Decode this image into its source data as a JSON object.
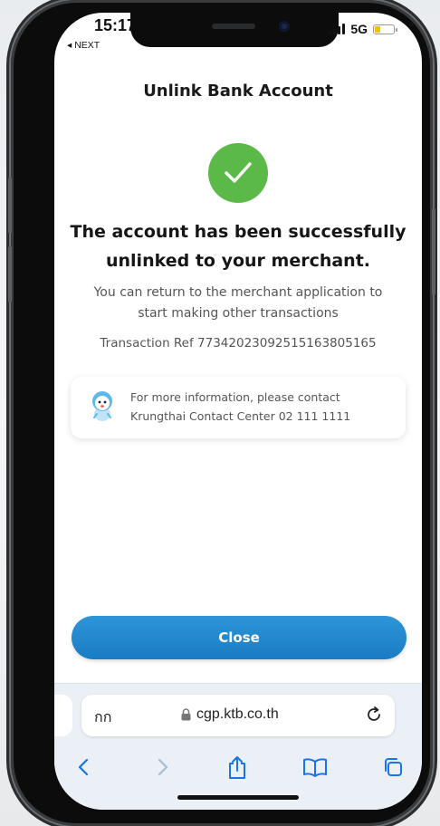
{
  "status_bar": {
    "time": "15:17",
    "back_app": "◂ NEXT",
    "network": "5G"
  },
  "page": {
    "title": "Unlink Bank Account",
    "headline_line1": "The account has been successfully",
    "headline_line2": "unlinked to your merchant.",
    "subtext_line1": "You can return to the merchant application to",
    "subtext_line2": "start making other transactions",
    "transaction_ref": "Transaction Ref 7734202309251516380516​5"
  },
  "contact": {
    "line1": "For more information, please contact",
    "line2": "Krungthai Contact Center 02 111 1111"
  },
  "close_button": {
    "label": "Close"
  },
  "browser": {
    "text_size_label": "กก",
    "url": "cgp.ktb.co.th"
  },
  "colors": {
    "success": "#5ab947",
    "primary": "#1a7cc4",
    "toolbar_icon": "#1a73e8"
  },
  "icons": [
    "check-icon",
    "mascot-icon",
    "lock-icon",
    "reload-icon",
    "back-icon",
    "forward-icon",
    "share-icon",
    "bookmarks-icon",
    "tabs-icon"
  ]
}
